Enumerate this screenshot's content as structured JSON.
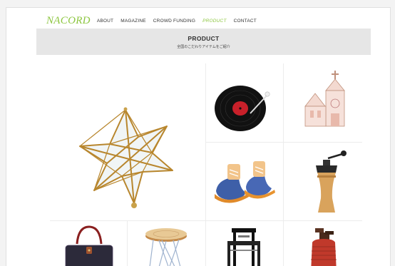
{
  "nav": {
    "logo": "NACORD",
    "links": [
      "ABOUT",
      "MAGAZINE",
      "CROWD FUNDING",
      "PRODUCT",
      "CONTACT"
    ],
    "active": "PRODUCT"
  },
  "banner": {
    "title": "PRODUCT",
    "subtitle": "全国のこだわりアイテムをご紹介"
  },
  "colors": {
    "accent": "#8cc63f",
    "banner_bg": "#e6e6e6"
  },
  "products": [
    {
      "icon": "brass-star-ornament-icon"
    },
    {
      "icon": "record-plate-icon"
    },
    {
      "icon": "castle-lamp-icon"
    },
    {
      "icon": "baby-shoes-icon"
    },
    {
      "icon": "coffee-grinder-icon"
    },
    {
      "icon": "knit-bag-icon"
    },
    {
      "icon": "wooden-stool-icon"
    },
    {
      "icon": "chair-icon"
    },
    {
      "icon": "red-vase-icon"
    }
  ]
}
